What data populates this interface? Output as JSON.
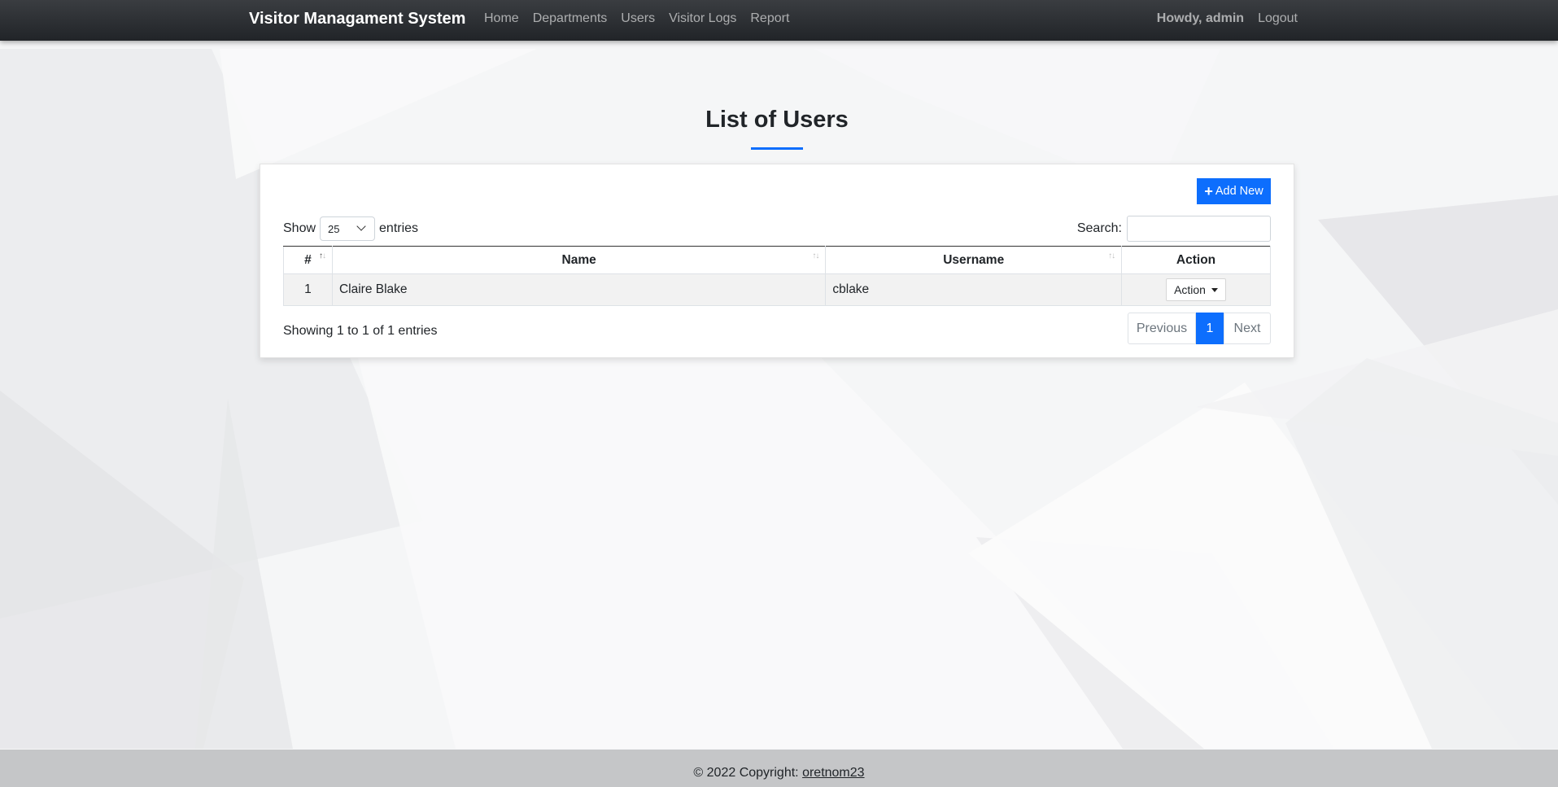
{
  "navbar": {
    "brand": "Visitor Managament System",
    "links": [
      "Home",
      "Departments",
      "Users",
      "Visitor Logs",
      "Report"
    ],
    "greeting": "Howdy, admin",
    "logout": "Logout"
  },
  "page": {
    "title": "List of Users"
  },
  "card": {
    "add_button": "Add New",
    "show_label": "Show",
    "entries_label": "entries",
    "page_length": "25",
    "search_label": "Search:",
    "search_value": ""
  },
  "table": {
    "columns": [
      "#",
      "Name",
      "Username",
      "Action"
    ],
    "rows": [
      {
        "num": "1",
        "name": "Claire Blake",
        "username": "cblake",
        "action": "Action"
      }
    ]
  },
  "info": {
    "showing": "Showing 1 to 1 of 1 entries"
  },
  "pagination": {
    "previous": "Previous",
    "current": "1",
    "next": "Next"
  },
  "footer": {
    "text": "© 2022 Copyright: ",
    "link": "oretnom23"
  },
  "colors": {
    "accent": "#0d6efd",
    "navbar": "#2a2d31",
    "footer": "#c5c6c8"
  }
}
